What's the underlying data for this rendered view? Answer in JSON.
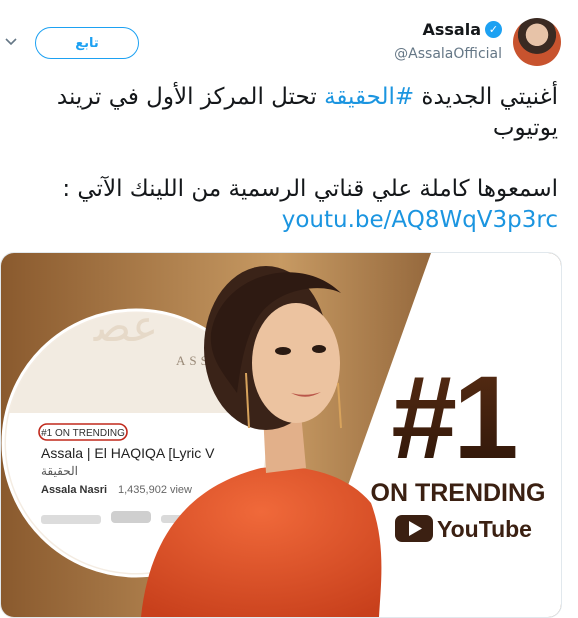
{
  "user": {
    "name": "Assala",
    "handle": "@AssalaOfficial",
    "verified_mark": "✓"
  },
  "follow_label": "تابع",
  "tweet": {
    "line1_before": "أغنيتي الجديدة ",
    "hashtag": "#الحقيقة",
    "line1_after": " تحتل المركز الأول في تريند يوتيوب",
    "line2_before": "اسمعوها كاملة علي قناتي الرسمية من اللينك الآتي : ",
    "link": "youtu.be/AQ8WqV3p3rc"
  },
  "media": {
    "brand": "ASSALA",
    "trending_badge": "#1 ON TRENDING",
    "video_title": "Assala | El HAQIQA [Lyric V",
    "video_subtitle_ar": "الحقيقة",
    "channel": "Assala Nasri",
    "views": "1,435,902 view",
    "big_rank": "#1",
    "on_trending": "ON TRENDING",
    "platform": "YouTube"
  },
  "icons": {
    "chevron": "chevron-down-icon",
    "verified": "verified-badge-icon",
    "play": "youtube-play-icon"
  },
  "colors": {
    "accent": "#1da1f2",
    "link": "#1b95e0",
    "dark_brown": "#3b2012"
  }
}
